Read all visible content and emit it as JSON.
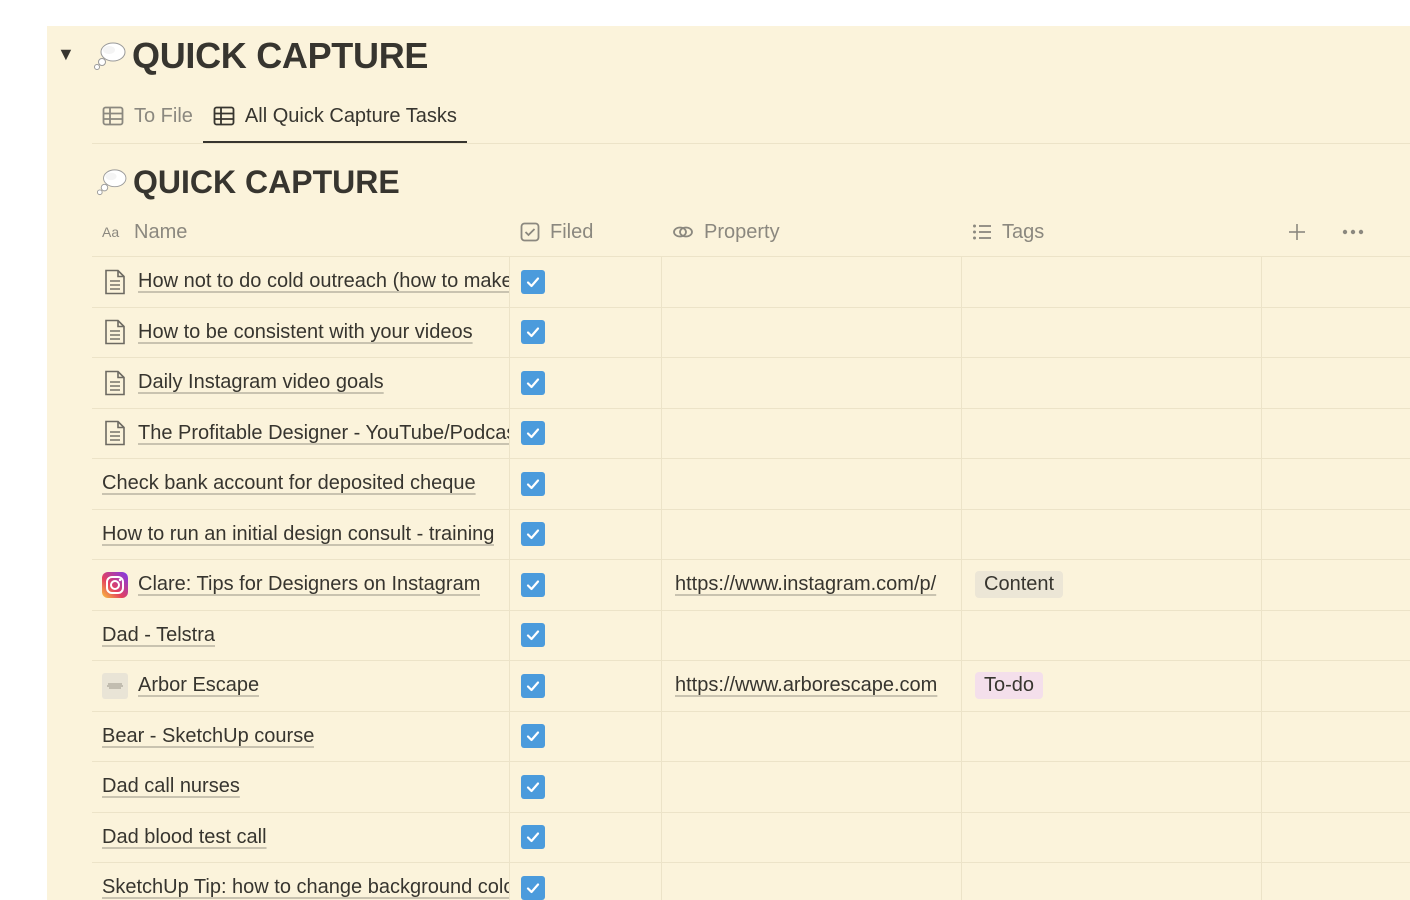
{
  "section": {
    "title": "QUICK CAPTURE",
    "emoji": "thought-bubble"
  },
  "tabs": [
    {
      "label": "To File",
      "icon": "table-icon",
      "active": false
    },
    {
      "label": "All Quick Capture Tasks",
      "icon": "table-icon",
      "active": true
    }
  ],
  "database": {
    "title": "QUICK CAPTURE"
  },
  "columns": {
    "name": "Name",
    "filed": "Filed",
    "property": "Property",
    "tags": "Tags"
  },
  "rows": [
    {
      "name": "How not to do cold outreach (how to make it personal)",
      "icon": "page",
      "filed": true,
      "property": "",
      "tag": ""
    },
    {
      "name": "How to be consistent with your videos",
      "icon": "page",
      "filed": true,
      "property": "",
      "tag": ""
    },
    {
      "name": "Daily Instagram video goals",
      "icon": "page",
      "filed": true,
      "property": "",
      "tag": ""
    },
    {
      "name": "The Profitable Designer - YouTube/Podcast",
      "icon": "page",
      "filed": true,
      "property": "",
      "tag": ""
    },
    {
      "name": "Check bank account for deposited cheque",
      "icon": "",
      "filed": true,
      "property": "",
      "tag": ""
    },
    {
      "name": "How to run an initial design consult - training",
      "icon": "",
      "filed": true,
      "property": "",
      "tag": ""
    },
    {
      "name": "Clare: Tips for Designers on Instagram",
      "icon": "instagram",
      "filed": true,
      "property": "https://www.instagram.com/p/",
      "tag": "Content"
    },
    {
      "name": "Dad - Telstra",
      "icon": "",
      "filed": true,
      "property": "",
      "tag": ""
    },
    {
      "name": "Arbor Escape",
      "icon": "favicon",
      "filed": true,
      "property": "https://www.arborescape.com",
      "tag": "To-do"
    },
    {
      "name": "Bear - SketchUp course",
      "icon": "",
      "filed": true,
      "property": "",
      "tag": ""
    },
    {
      "name": "Dad call nurses",
      "icon": "",
      "filed": true,
      "property": "",
      "tag": ""
    },
    {
      "name": "Dad blood test call",
      "icon": "",
      "filed": true,
      "property": "",
      "tag": ""
    },
    {
      "name": "SketchUp Tip: how to change background colour",
      "icon": "",
      "filed": true,
      "property": "",
      "tag": ""
    }
  ],
  "tag_colors": {
    "Content": "#ece6d6",
    "To-do": "#f4dfeb"
  },
  "colors": {
    "panel_bg": "#fbf3db",
    "checkbox": "#4b9bdc",
    "text": "#37352f",
    "muted": "#8b887f"
  }
}
